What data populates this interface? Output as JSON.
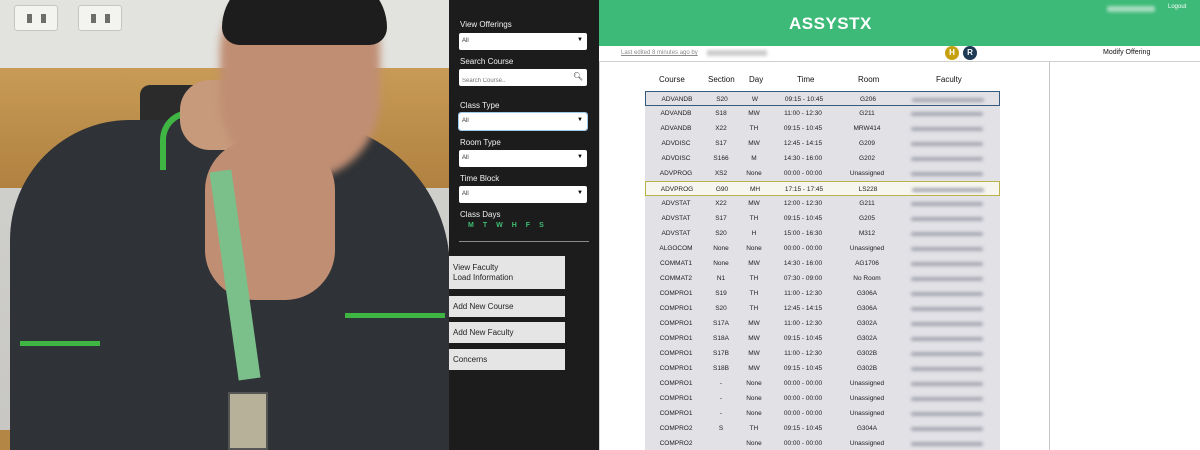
{
  "sidebar": {
    "view_offerings_label": "View Offerings",
    "view_offerings_value": "All",
    "search_course_label": "Search Course",
    "search_placeholder": "Search Course..",
    "class_type_label": "Class Type",
    "class_type_value": "All",
    "room_type_label": "Room Type",
    "room_type_value": "All",
    "time_block_label": "Time Block",
    "time_block_value": "All",
    "class_days_label": "Class Days",
    "days": [
      "M",
      "T",
      "W",
      "H",
      "F",
      "S"
    ],
    "buttons": {
      "view_faculty_line1": "View Faculty",
      "view_faculty_line2": "Load Information",
      "add_course": "Add New Course",
      "add_faculty": "Add New Faculty",
      "concerns": "Concerns"
    }
  },
  "header": {
    "title": "ASSYSTX",
    "logout": "Logout"
  },
  "toolbar": {
    "last_edited": "Last edited 8 minutes ago by",
    "h_button": "H",
    "r_button": "R",
    "modify_offering": "Modify Offering"
  },
  "table": {
    "headers": [
      "Course",
      "Section",
      "Day",
      "Time",
      "Room",
      "Faculty"
    ],
    "rows": [
      {
        "course": "ADVANDB",
        "section": "S20",
        "day": "W",
        "time": "09:15 - 10:45",
        "room": "G206"
      },
      {
        "course": "ADVANDB",
        "section": "S18",
        "day": "MW",
        "time": "11:00 - 12:30",
        "room": "G211"
      },
      {
        "course": "ADVANDB",
        "section": "X22",
        "day": "TH",
        "time": "09:15 - 10:45",
        "room": "MRW414"
      },
      {
        "course": "ADVDISC",
        "section": "S17",
        "day": "MW",
        "time": "12:45 - 14:15",
        "room": "G209"
      },
      {
        "course": "ADVDISC",
        "section": "S166",
        "day": "M",
        "time": "14:30 - 16:00",
        "room": "G202"
      },
      {
        "course": "ADVPROG",
        "section": "XS2",
        "day": "None",
        "time": "00:00 - 00:00",
        "room": "Unassigned"
      },
      {
        "course": "ADVPROG",
        "section": "G90",
        "day": "MH",
        "time": "17:15 - 17:45",
        "room": "LS228"
      },
      {
        "course": "ADVSTAT",
        "section": "X22",
        "day": "MW",
        "time": "12:00 - 12:30",
        "room": "G211"
      },
      {
        "course": "ADVSTAT",
        "section": "S17",
        "day": "TH",
        "time": "09:15 - 10:45",
        "room": "G205"
      },
      {
        "course": "ADVSTAT",
        "section": "S20",
        "day": "H",
        "time": "15:00 - 16:30",
        "room": "M312"
      },
      {
        "course": "ALGOCOM",
        "section": "None",
        "day": "None",
        "time": "00:00 - 00:00",
        "room": "Unassigned"
      },
      {
        "course": "COMMAT1",
        "section": "None",
        "day": "MW",
        "time": "14:30 - 16:00",
        "room": "AG1706"
      },
      {
        "course": "COMMAT2",
        "section": "N1",
        "day": "TH",
        "time": "07:30 - 09:00",
        "room": "No Room"
      },
      {
        "course": "COMPRO1",
        "section": "S19",
        "day": "TH",
        "time": "11:00 - 12:30",
        "room": "G306A"
      },
      {
        "course": "COMPRO1",
        "section": "S20",
        "day": "TH",
        "time": "12:45 - 14:15",
        "room": "G306A"
      },
      {
        "course": "COMPRO1",
        "section": "S17A",
        "day": "MW",
        "time": "11:00 - 12:30",
        "room": "G302A"
      },
      {
        "course": "COMPRO1",
        "section": "S18A",
        "day": "MW",
        "time": "09:15 - 10:45",
        "room": "G302A"
      },
      {
        "course": "COMPRO1",
        "section": "S17B",
        "day": "MW",
        "time": "11:00 - 12:30",
        "room": "G302B"
      },
      {
        "course": "COMPRO1",
        "section": "S18B",
        "day": "MW",
        "time": "09:15 - 10:45",
        "room": "G302B"
      },
      {
        "course": "COMPRO1",
        "section": "-",
        "day": "None",
        "time": "00:00 - 00:00",
        "room": "Unassigned"
      },
      {
        "course": "COMPRO1",
        "section": "-",
        "day": "None",
        "time": "00:00 - 00:00",
        "room": "Unassigned"
      },
      {
        "course": "COMPRO1",
        "section": "-",
        "day": "None",
        "time": "00:00 - 00:00",
        "room": "Unassigned"
      },
      {
        "course": "COMPRO2",
        "section": "S",
        "day": "TH",
        "time": "09:15 - 10:45",
        "room": "G304A"
      },
      {
        "course": "COMPRO2",
        "section": "",
        "day": "None",
        "time": "00:00 - 00:00",
        "room": "Unassigned"
      }
    ],
    "selected_rows": {
      "blue": 0,
      "yellow": 6
    }
  }
}
